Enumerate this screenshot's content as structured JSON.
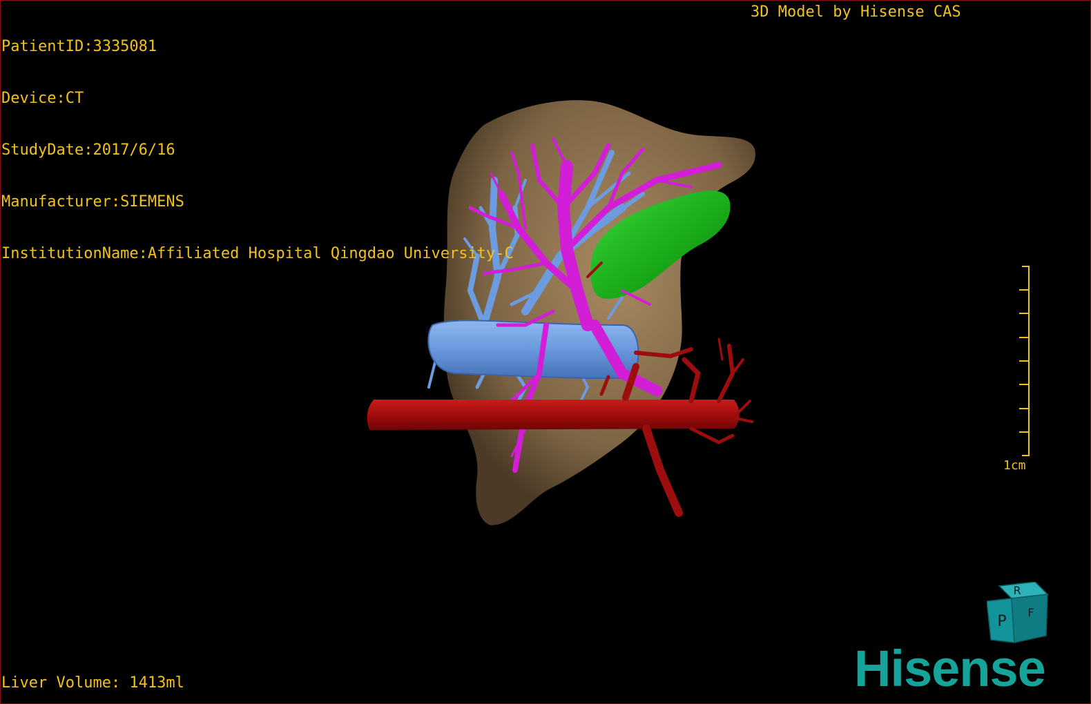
{
  "header": {
    "patient_id": "PatientID:3335081",
    "device": "Device:CT",
    "study_date": "StudyDate:2017/6/16",
    "manufacturer": "Manufacturer:SIEMENS",
    "institution": "InstitutionName:Affiliated Hospital Qingdao University-C",
    "model_credit": "3D Model by Hisense CAS"
  },
  "footer": {
    "liver_volume": "Liver Volume: 1413ml"
  },
  "scale": {
    "label": "1cm"
  },
  "orientation_cube": {
    "top_face_letter": "R",
    "front_face_letter": "P",
    "side_face_letter": "F"
  },
  "brand": {
    "name": "Hisense"
  },
  "colors": {
    "overlay_text": "#f2c21a",
    "liver": "#8a6e4c",
    "portal_vein": "#d21ed6",
    "hepatic_vein": "#6c9be0",
    "aorta": "#a50f0f",
    "gallbladder": "#1cbb1c",
    "brand": "#16a39a",
    "frame_border": "#8a1010"
  }
}
